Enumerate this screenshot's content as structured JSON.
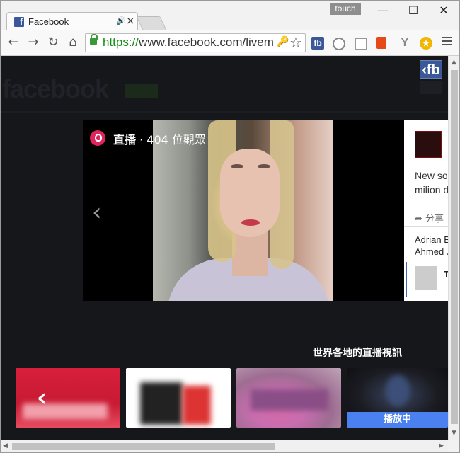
{
  "window": {
    "tab_title": "Facebook",
    "tab_favicon": "f",
    "touch_label": "touch",
    "minimize": "—",
    "maximize": "☐",
    "close": "✕"
  },
  "toolbar": {
    "url_scheme": "https://",
    "url_rest": "www.facebook.com/livem",
    "extensions": [
      {
        "name": "fb-extension-icon",
        "label": "fb",
        "color": "#3b5998"
      },
      {
        "name": "compass-icon",
        "label": "",
        "color": "#888888"
      },
      {
        "name": "share-icon",
        "label": "",
        "color": "#888888"
      },
      {
        "name": "office-icon",
        "label": "",
        "color": "#e64a19"
      },
      {
        "name": "tuning-fork-icon",
        "label": "",
        "color": "#888888"
      },
      {
        "name": "star-badge-icon",
        "label": "",
        "color": "#f2b600"
      }
    ]
  },
  "page": {
    "bg_logo": "facebook",
    "corner_logo": "‹fb",
    "live": {
      "label": "直播",
      "separator": " · ",
      "viewers": "404 位觀眾"
    },
    "side": {
      "text_line1": "New so",
      "text_line2": "milion d",
      "share": "➦ 分享",
      "name_line1": "Adrian B",
      "name_line2": "Ahmed J",
      "card_text": "Tu"
    },
    "world_title": "世界各地的直播視訊",
    "playing_label": "播放中"
  },
  "colors": {
    "brand": "#3b5998",
    "live_red": "#e0245e",
    "playing_blue": "#4a80f0",
    "page_bg": "#16171b"
  }
}
